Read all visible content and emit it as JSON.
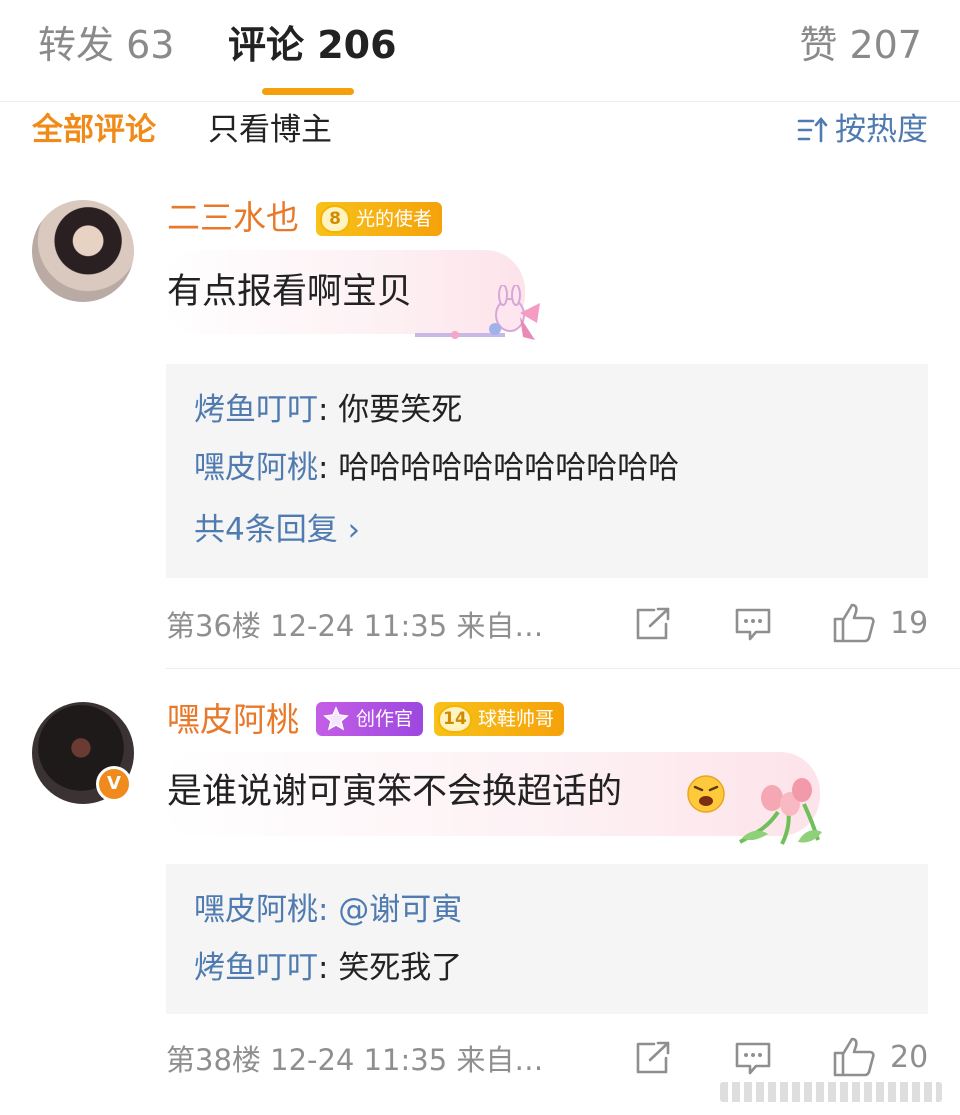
{
  "tabs": [
    {
      "label": "转发 63"
    },
    {
      "label": "评论 206"
    },
    {
      "label": "赞 207"
    }
  ],
  "filters": {
    "all": "全部评论",
    "owner_only": "只看博主",
    "sort": "按热度"
  },
  "comments": [
    {
      "username": "二三水也",
      "badge": {
        "level": "8",
        "title": "光的使者"
      },
      "text": "有点报看啊宝贝",
      "replies": [
        {
          "name": "烤鱼叮叮",
          "text": ": 你要笑死"
        },
        {
          "name": "嘿皮阿桃",
          "text": ": 哈哈哈哈哈哈哈哈哈哈哈"
        }
      ],
      "more_replies": "共4条回复 ›",
      "meta": "第36楼 12-24 11:35 来自…",
      "likes": "19"
    },
    {
      "username": "嘿皮阿桃",
      "badges": [
        {
          "title": "创作官"
        },
        {
          "level": "14",
          "title": "球鞋帅哥"
        }
      ],
      "verified": "V",
      "text": "是谁说谢可寅笨不会换超话的",
      "replies": [
        {
          "name": "嘿皮阿桃",
          "text": ": @谢可寅"
        },
        {
          "name": "烤鱼叮叮",
          "text": ": 笑死我了"
        }
      ],
      "meta": "第38楼 12-24 11:35 来自…",
      "likes": "20"
    }
  ],
  "colors": {
    "accent": "#f3a00c",
    "username": "#e8782a",
    "link": "#4f7bb0"
  }
}
